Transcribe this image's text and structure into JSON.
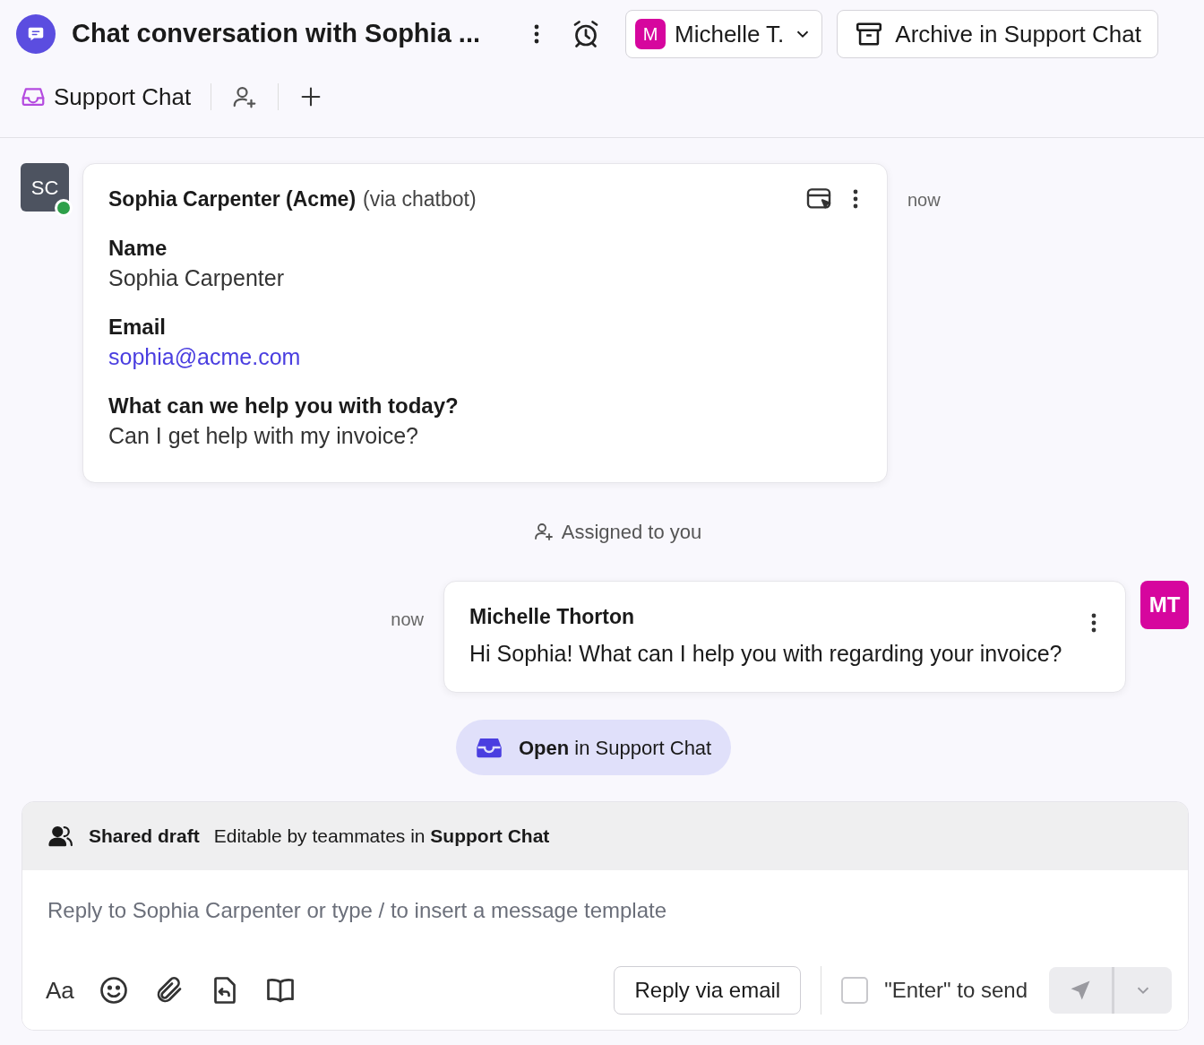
{
  "header": {
    "title": "Chat conversation with Sophia ...",
    "assignee": {
      "initial": "M",
      "name": "Michelle T.",
      "color": "#d6069e"
    },
    "archive_button": "Archive in Support Chat"
  },
  "tabs": [
    {
      "label": "Support Chat",
      "selected": true
    }
  ],
  "messages": [
    {
      "kind": "form",
      "avatar": "SC",
      "online": true,
      "author": "Sophia Carpenter (Acme)",
      "via": "(via chatbot)",
      "time": "now",
      "fields": [
        {
          "label": "Name",
          "value": "Sophia Carpenter",
          "kind": "text"
        },
        {
          "label": "Email",
          "value": "sophia@acme.com",
          "kind": "link"
        },
        {
          "label": "What can we help you with today?",
          "value": "Can I get help with my invoice?",
          "kind": "text"
        }
      ]
    },
    {
      "kind": "event",
      "text": "Assigned to you"
    },
    {
      "kind": "reply",
      "avatar": "MT",
      "color": "#d6069e",
      "author": "Michelle Thorton",
      "time": "now",
      "text": "Hi Sophia! What can I help you with regarding your invoice?"
    }
  ],
  "open_button": "**Open** in Support Chat",
  "composer": {
    "draft_title": "Shared draft",
    "draft_note": "Editable by teammates in **Support Chat**",
    "placeholder": "Reply to Sophia Carpenter or type / to insert a message template",
    "format_label": "Aa",
    "reply_button": "Reply via email",
    "enter_to_send": {
      "label": "\"Enter\" to send",
      "checked": false
    }
  }
}
